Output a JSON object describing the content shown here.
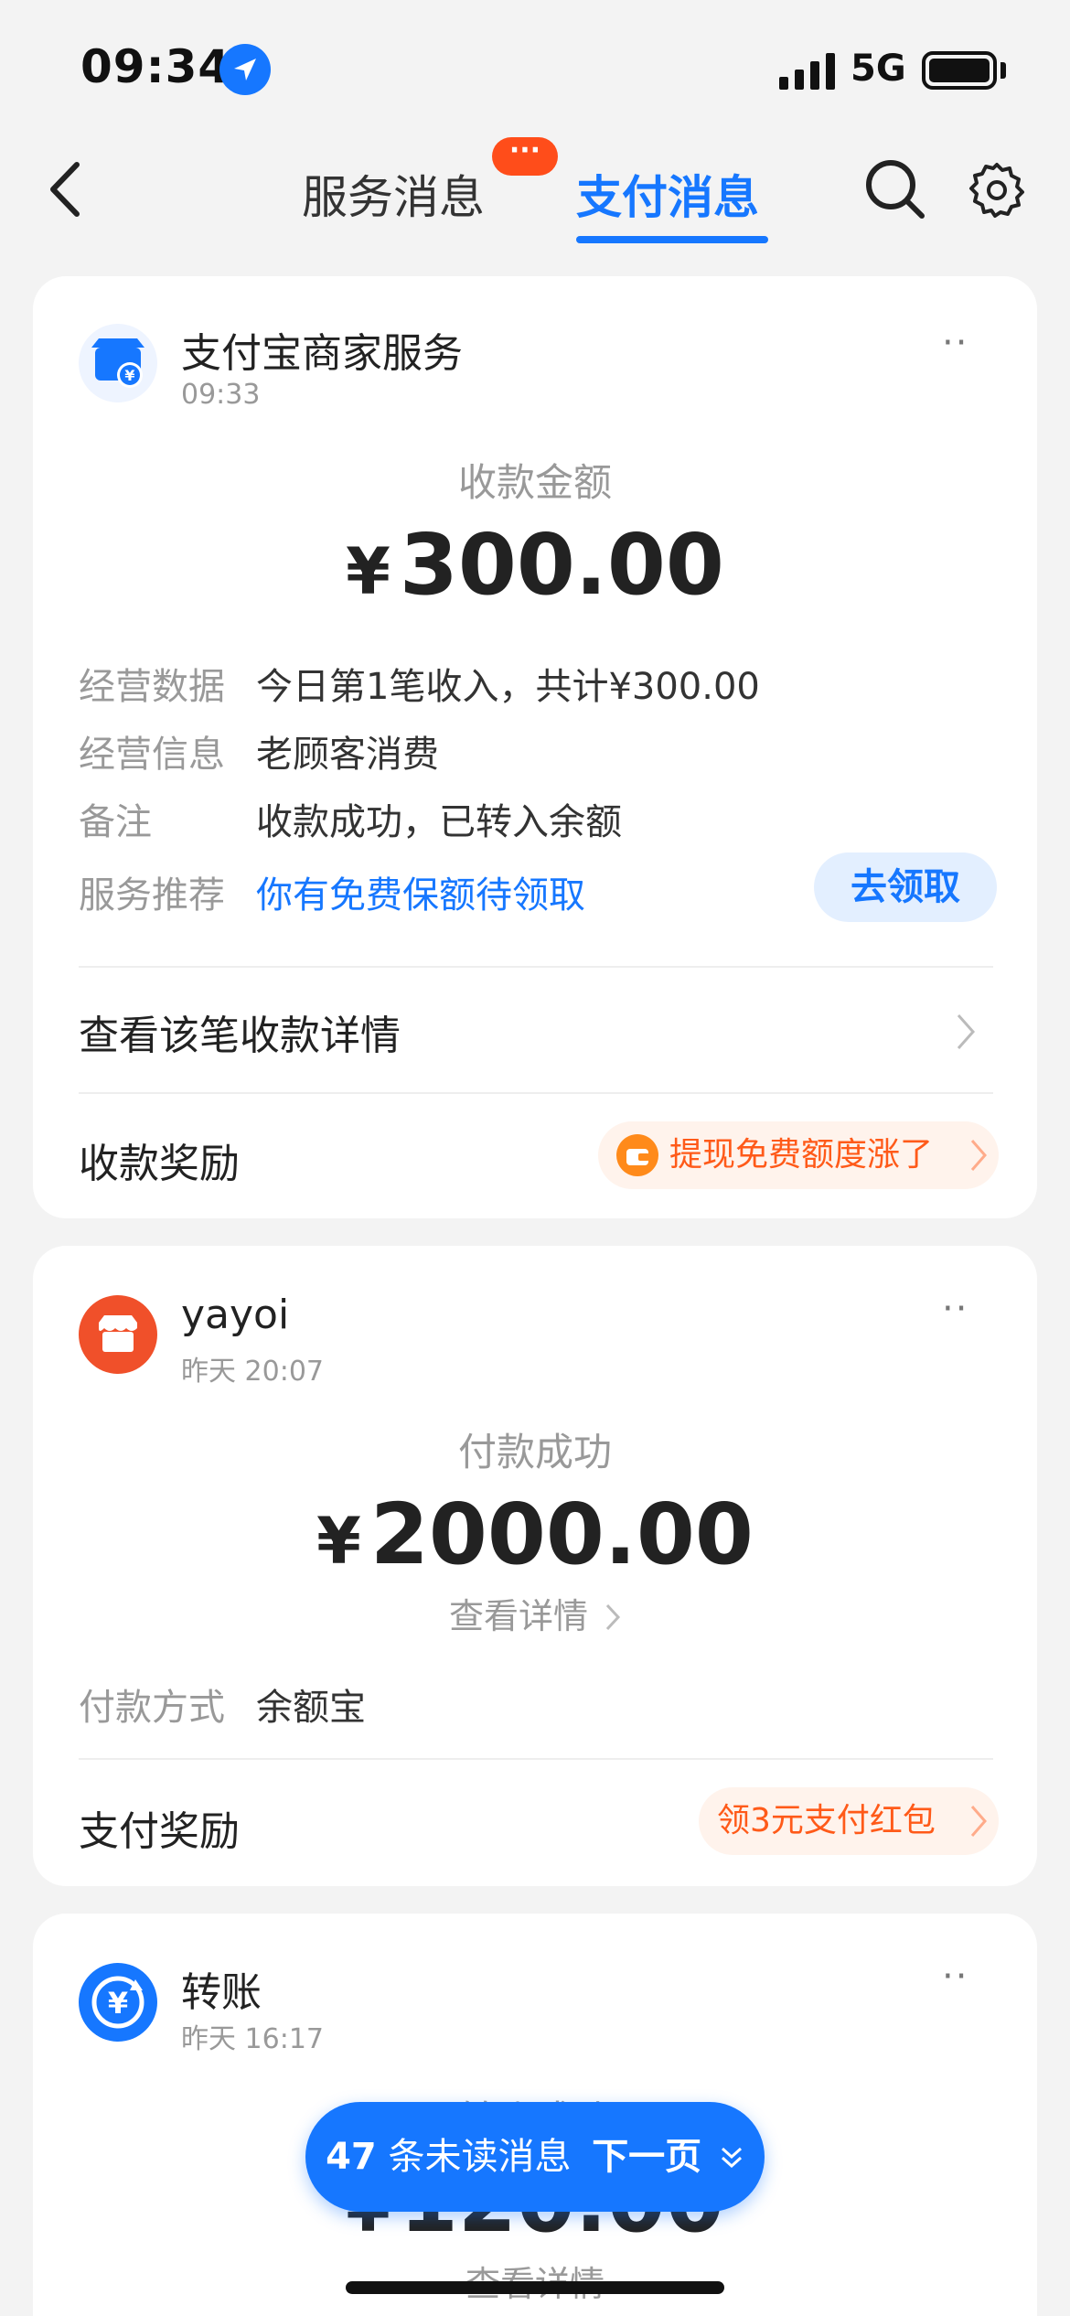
{
  "status_bar": {
    "time": "09:34",
    "network": "5G"
  },
  "nav": {
    "tabs": [
      {
        "label": "服务消息"
      },
      {
        "label": "支付消息"
      }
    ],
    "badge": "···",
    "active_tab": "支付消息"
  },
  "cards": [
    {
      "merchant": "支付宝商家服务",
      "time": "09:33",
      "caption": "收款金额",
      "currency": "¥",
      "amount": "300.00",
      "rows": [
        {
          "label": "经营数据",
          "value": "今日第1笔收入，共计¥300.00"
        },
        {
          "label": "经营信息",
          "value": "老顾客消费"
        },
        {
          "label": "备注",
          "value": "收款成功，已转入余额"
        },
        {
          "label": "服务推荐",
          "value": "你有免费保额待领取",
          "button": "去领取"
        }
      ],
      "detail_link": "查看该笔收款详情",
      "reward_title": "收款奖励",
      "reward_pill": "提现免费额度涨了"
    },
    {
      "merchant": "yayoi",
      "time": "昨天 20:07",
      "caption": "付款成功",
      "currency": "¥",
      "amount": "2000.00",
      "detail_link": "查看详情",
      "rows": [
        {
          "label": "付款方式",
          "value": "余额宝"
        }
      ],
      "reward_title": "支付奖励",
      "reward_pill": "领3元支付红包"
    },
    {
      "merchant": "转账",
      "time": "昨天 16:17",
      "caption": "转账成功",
      "currency": "¥",
      "amount": "120.00",
      "detail_link": "查看详情"
    }
  ],
  "floating": {
    "count": "47",
    "unread_text": "条未读消息",
    "next_page": "下一页"
  },
  "colors": {
    "accent": "#1677ff",
    "badge": "#ff4d1a",
    "reward": "#ff5a19",
    "merchant_orange": "#f0502a"
  }
}
